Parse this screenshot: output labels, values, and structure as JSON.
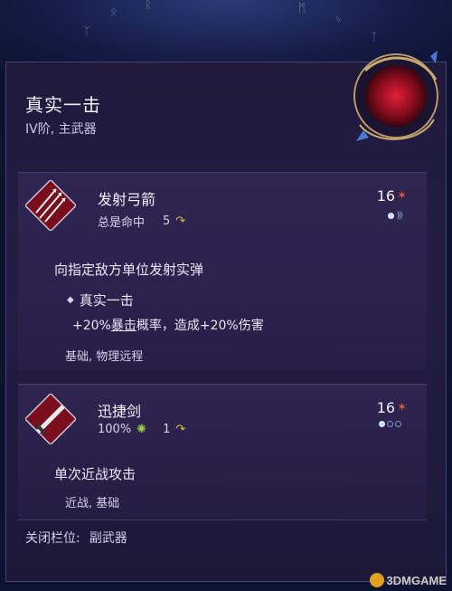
{
  "header": {
    "title": "真实一击",
    "subtitle": "IV阶, 主武器"
  },
  "skills": [
    {
      "name": "发射弓箭",
      "meta_text": "总是命中",
      "meta_value": "5",
      "cost": "16",
      "pips": [
        true,
        false,
        false,
        false
      ],
      "description": "向指定敌方单位发射实弹",
      "passive": {
        "title": "真实一击",
        "line_pre": "+20%",
        "line_keyword": "暴击",
        "line_post": "概率，造成+20%伤害"
      },
      "tags": "基础, 物理远程"
    },
    {
      "name": "迅捷剑",
      "meta_text": "100%",
      "meta_value": "1",
      "cost": "16",
      "pips": [
        true,
        false,
        false
      ],
      "description": "单次近战攻击",
      "tags": "近战, 基础"
    }
  ],
  "footer": {
    "label": "关闭栏位:",
    "value": "副武器"
  },
  "watermark": "3DMGAME",
  "colors": {
    "panel": "#1f1a3c",
    "accent_red": "#c0182a",
    "pip_blue": "#c7dcff"
  }
}
